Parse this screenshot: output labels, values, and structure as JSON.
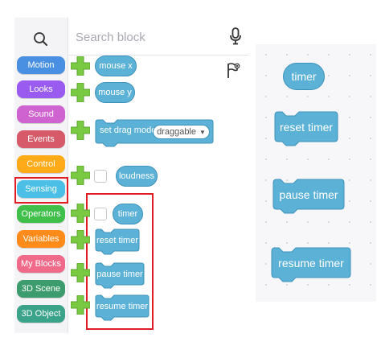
{
  "search": {
    "placeholder": "Search block"
  },
  "categories": [
    {
      "label": "Motion",
      "color": "#4a90e2"
    },
    {
      "label": "Looks",
      "color": "#9a5cf0"
    },
    {
      "label": "Sound",
      "color": "#cf63cf"
    },
    {
      "label": "Events",
      "color": "#d65a69"
    },
    {
      "label": "Control",
      "color": "#ffab19"
    },
    {
      "label": "Sensing",
      "color": "#4cbfe6",
      "selected": true
    },
    {
      "label": "Operators",
      "color": "#40bf4a"
    },
    {
      "label": "Variables",
      "color": "#ff8c1a"
    },
    {
      "label": "My Blocks",
      "color": "#f06a8a"
    },
    {
      "label": "3D Scene",
      "color": "#3d9c6e"
    },
    {
      "label": "3D Object",
      "color": "#3aa38a"
    }
  ],
  "blocks": {
    "mouse_x": "mouse x",
    "mouse_y": "mouse y",
    "set_drag_mode": "set drag mode",
    "drag_mode_value": "draggable",
    "loudness": "loudness",
    "timer": "timer",
    "reset_timer": "reset timer",
    "pause_timer": "pause timer",
    "resume_timer": "resume timer"
  },
  "preview": {
    "timer": "timer",
    "reset_timer": "reset timer",
    "pause_timer": "pause timer",
    "resume_timer": "resume timer"
  },
  "colors": {
    "block_fill": "#5cb1d6",
    "block_border": "#3f93bb",
    "plus": "#7ac943",
    "highlight": "#e11c24"
  }
}
